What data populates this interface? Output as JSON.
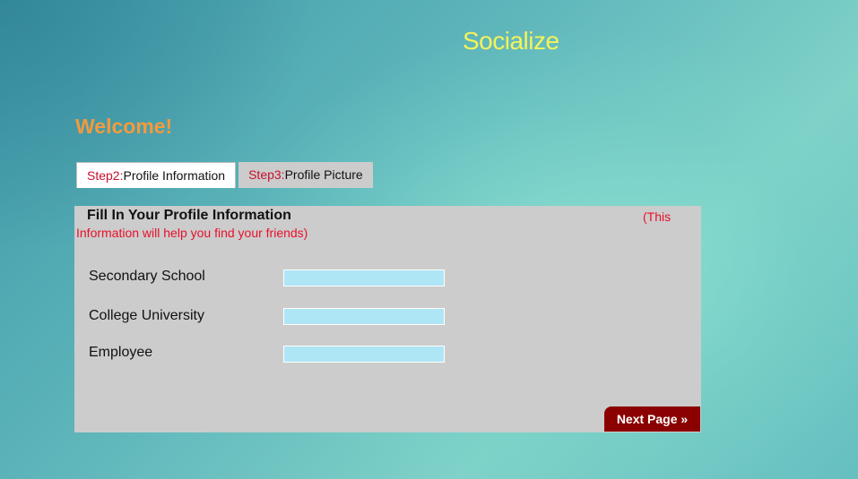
{
  "header": {
    "brand": "Socialize",
    "welcome": "Welcome!"
  },
  "tabs": [
    {
      "step": "Step2:",
      "label": "Profile Information",
      "active": true
    },
    {
      "step": "Step3:",
      "label": "Profile Picture",
      "active": false
    }
  ],
  "form": {
    "title": "Fill In Your Profile Information",
    "note_part1": "(This",
    "note_part2": "Information will help you find your friends)",
    "fields": [
      {
        "label": "Secondary School",
        "value": ""
      },
      {
        "label": "College University",
        "value": ""
      },
      {
        "label": "Employee",
        "value": ""
      }
    ],
    "next_label": "Next Page »"
  },
  "colors": {
    "brand": "#f4f35a",
    "welcome": "#f39a3e",
    "step_text": "#c8102e",
    "note_text": "#e8102a",
    "panel_bg": "#cccccc",
    "input_bg": "#aee6f6",
    "button_bg": "#8b0000"
  }
}
